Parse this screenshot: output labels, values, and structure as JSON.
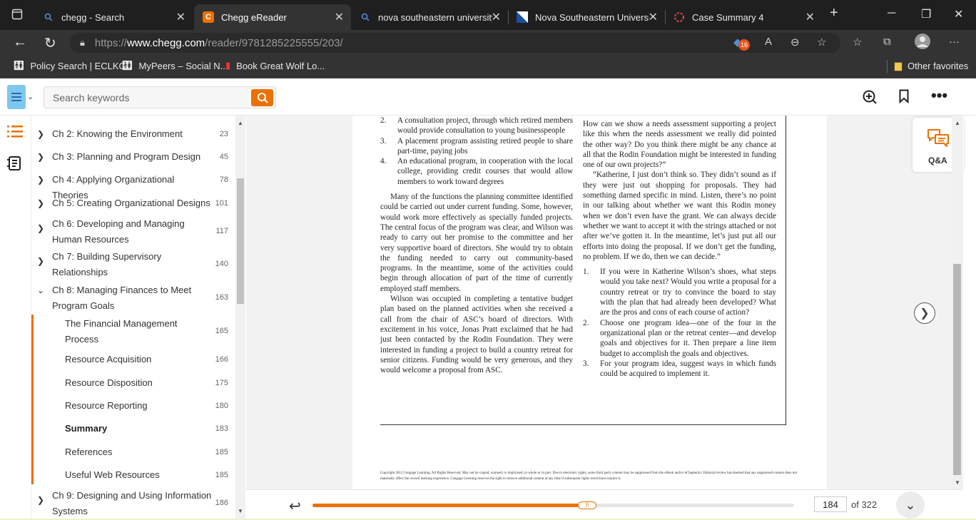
{
  "browser": {
    "tabs": [
      {
        "label": "chegg - Search",
        "icon": "search-icon"
      },
      {
        "label": "Chegg eReader",
        "icon": "chegg-logo-icon"
      },
      {
        "label": "nova southeastern university",
        "icon": "search-icon"
      },
      {
        "label": "Nova Southeastern University",
        "icon": "nsu-icon"
      },
      {
        "label": "Case Summary 4",
        "icon": "loading-icon"
      }
    ],
    "url_prefix": "https://",
    "url_host": "www.chegg.com",
    "url_path": "/reader/9781285225555/203/",
    "extension_badge": "16",
    "bookmarks": [
      {
        "label": "Policy Search | ECLKC"
      },
      {
        "label": "MyPeers – Social N..."
      },
      {
        "label": "Book Great Wolf Lo..."
      }
    ],
    "other_favorites": "Other favorites"
  },
  "header": {
    "search_placeholder": "Search keywords"
  },
  "toc": [
    {
      "label": "Ch 2: Knowing the Environment",
      "page": "23",
      "level": 0,
      "chevron": "right"
    },
    {
      "label": "Ch 3: Planning and Program Design",
      "page": "45",
      "level": 0,
      "chevron": "right"
    },
    {
      "label": "Ch 4: Applying Organizational Theories",
      "page": "78",
      "level": 0,
      "chevron": "right"
    },
    {
      "label": "Ch 5: Creating Organizational Designs",
      "page": "101",
      "level": 0,
      "chevron": "right"
    },
    {
      "label": "Ch 6: Developing and Managing Human Resources",
      "page": "117",
      "level": 0,
      "chevron": "right"
    },
    {
      "label": "Ch 7: Building Supervisory Relationships",
      "page": "140",
      "level": 0,
      "chevron": "right"
    },
    {
      "label": "Ch 8: Managing Finances to Meet Program Goals",
      "page": "163",
      "level": 0,
      "chevron": "down"
    },
    {
      "label": "The Financial Management Process",
      "page": "165",
      "level": 1
    },
    {
      "label": "Resource Acquisition",
      "page": "166",
      "level": 1
    },
    {
      "label": "Resource Disposition",
      "page": "175",
      "level": 1
    },
    {
      "label": "Resource Reporting",
      "page": "180",
      "level": 1
    },
    {
      "label": "Summary",
      "page": "183",
      "level": 1,
      "current": true
    },
    {
      "label": "References",
      "page": "185",
      "level": 1
    },
    {
      "label": "Useful Web Resources",
      "page": "185",
      "level": 1
    },
    {
      "label": "Ch 9: Designing and Using Information Systems",
      "page": "186",
      "level": 0,
      "chevron": "right"
    }
  ],
  "qa_label": "Q&A",
  "book": {
    "left_list": [
      {
        "n": "2.",
        "text": "A consultation project, through which retired members would provide consultation to young businesspeople"
      },
      {
        "n": "3.",
        "text": "A placement program assisting retired people to share part-time, paying jobs"
      },
      {
        "n": "4.",
        "text": "An educational program, in cooperation with the local college, providing credit courses that would allow members to work toward degrees"
      }
    ],
    "left_para1": "Many of the functions the planning committee identified could be carried out under current funding. Some, however, would work more effectively as specially funded projects. The central focus of the program was clear, and Wilson was ready to carry out her promise to the committee and her very supportive board of directors. She would try to obtain the funding needed to carry out community-based programs. In the meantime, some of the activities could begin through allocation of part of the time of currently employed staff members.",
    "left_para2": "Wilson was occupied in completing a tentative budget plan based on the planned activities when she received a call from the chair of ASC’s board of directors. With excitement in his voice, Jonas Pratt exclaimed that he had just been contacted by the Rodin Foundation. They were interested in funding a project to build a country retreat for senior citizens. Funding would be very generous, and they would welcome a proposal from ASC.",
    "right_para1": "How can we show a needs assessment supporting a project like this when the needs assessment we really did pointed the other way? Do you think there might be any chance at all that the Rodin Foundation might be interested in funding one of our own projects?”",
    "right_para2": "“Katherine, I just don’t think so. They didn’t sound as if they were just out shopping for proposals. They had something darned specific in mind. Listen, there’s no point in our talking about whether we want this Rodin money when we don’t even have the grant. We can always decide whether we want to accept it with the strings attached or not after we’ve gotten it. In the meantime, let’s just put all our efforts into doing the proposal. If we don’t get the funding, no problem. If we do, then we can decide.”",
    "questions": [
      {
        "n": "1.",
        "text": "If you were in Katherine Wilson’s shoes, what steps would you take next? Would you write a proposal for a country retreat or try to convince the board to stay with the plan that had already been developed? What are the pros and cons of each course of action?"
      },
      {
        "n": "2.",
        "text": "Choose one program idea—one of the four in the organizational plan or the retreat center—and develop goals and objectives for it. Then prepare a line item budget to accomplish the goals and objectives."
      },
      {
        "n": "3.",
        "text": "For your program idea, suggest ways in which funds could be acquired to implement it."
      }
    ],
    "copyright": "Copyright 2012 Cengage Learning. All Rights Reserved. May not be copied, scanned, or duplicated, in whole or in part. Due to electronic rights, some third party content may be suppressed from the eBook and/or eChapter(s). Editorial review has deemed that any suppressed content does not materially affect the overall learning experience. Cengage Learning reserves the right to remove additional content at any time if subsequent rights restrictions require it."
  },
  "footer": {
    "current_page": "184",
    "of_pages": "of 322",
    "progress_fraction": 0.57
  },
  "colors": {
    "accent": "#eb7100",
    "chrome_dark": "#1f1f1f",
    "chrome_mid": "#333333"
  }
}
